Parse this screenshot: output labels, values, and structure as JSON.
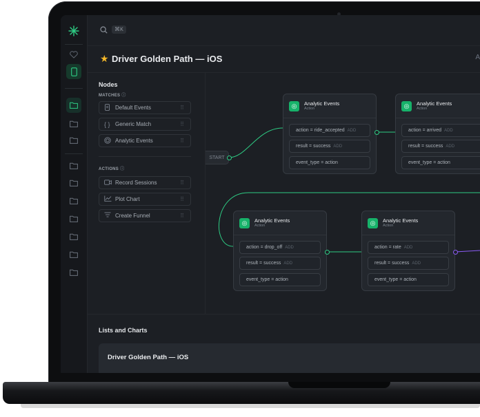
{
  "app": {
    "search_shortcut": "⌘K",
    "page_title": "Driver Golden Path — iOS",
    "header_action_partial": "A"
  },
  "rail": {
    "icons": [
      "logo-icon",
      "heart-icon",
      "phone-icon",
      "folder-icon",
      "folder-icon",
      "folder-icon",
      "folder-icon",
      "folder-icon",
      "folder-icon",
      "folder-icon",
      "folder-icon",
      "folder-icon",
      "folder-icon"
    ]
  },
  "panel": {
    "title": "Nodes",
    "matches_label": "MATCHES",
    "matches": [
      {
        "label": "Default Events",
        "icon": "document-icon"
      },
      {
        "label": "Generic Match",
        "icon": "braces-icon"
      },
      {
        "label": "Analytic Events",
        "icon": "target-icon"
      }
    ],
    "actions_label": "ACTIONS",
    "actions": [
      {
        "label": "Record Sessions",
        "icon": "video-icon"
      },
      {
        "label": "Plot Chart",
        "icon": "chart-icon"
      },
      {
        "label": "Create Funnel",
        "icon": "funnel-icon"
      }
    ]
  },
  "canvas": {
    "start_label": "START",
    "nodes": [
      {
        "title": "Analytic Events",
        "subtitle": "Action",
        "conditions": [
          {
            "text": "action = ride_accepted",
            "add": "ADD"
          },
          {
            "text": "result = success",
            "add": "ADD"
          },
          {
            "text": "event_type = action",
            "add": ""
          }
        ]
      },
      {
        "title": "Analytic Events",
        "subtitle": "Action",
        "conditions": [
          {
            "text": "action = arrived",
            "add": "ADD"
          },
          {
            "text": "result = success",
            "add": "ADD"
          },
          {
            "text": "event_type = action",
            "add": ""
          }
        ]
      },
      {
        "title": "Analytic Events",
        "subtitle": "Action",
        "conditions": [
          {
            "text": "action = drop_off",
            "add": "ADD"
          },
          {
            "text": "result = success",
            "add": "ADD"
          },
          {
            "text": "event_type = action",
            "add": ""
          }
        ]
      },
      {
        "title": "Analytic Events",
        "subtitle": "Action",
        "conditions": [
          {
            "text": "action = rate",
            "add": "ADD"
          },
          {
            "text": "result = success",
            "add": "ADD"
          },
          {
            "text": "event_type = action",
            "add": ""
          }
        ]
      }
    ]
  },
  "lists": {
    "title": "Lists and Charts",
    "card_title": "Driver Golden Path — iOS"
  },
  "colors": {
    "accent": "#2ecc84",
    "star": "#f5b829",
    "node_icon": "#17b26a",
    "purple_connector": "#8b5cf6"
  }
}
